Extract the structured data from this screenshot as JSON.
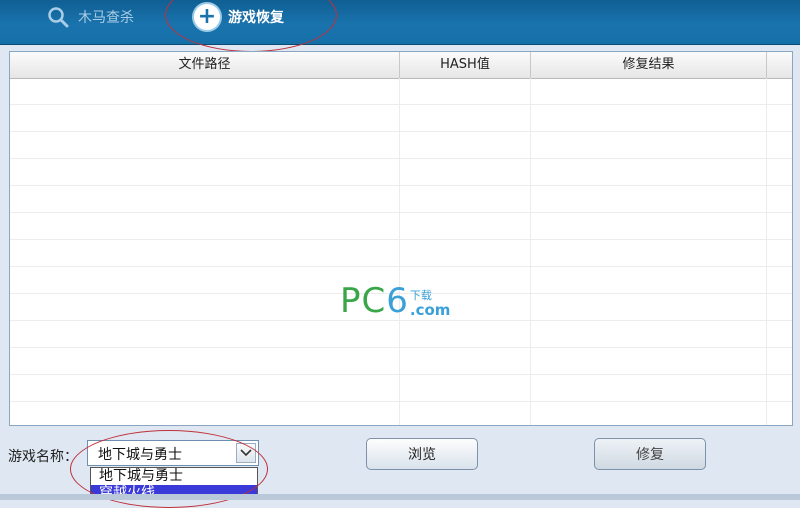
{
  "toolbar": {
    "scan_label": "木马查杀",
    "repair_label": "游戏恢复"
  },
  "table": {
    "headers": [
      "文件路径",
      "HASH值",
      "修复结果"
    ],
    "rows": []
  },
  "watermark": {
    "brand": "PC",
    "digit": "6",
    "cn": "下载",
    "com": ".com"
  },
  "controls": {
    "game_name_label": "游戏名称：",
    "game_selected": "地下城与勇士",
    "game_options": [
      "地下城与勇士",
      "穿越火线"
    ],
    "browse_label": "浏览",
    "repair_label": "修复"
  },
  "colors": {
    "toolbar_bg": "#1a73ad",
    "watermark_green": "#3aa64a",
    "watermark_blue": "#3aa0d8",
    "selected_option_bg": "#3a3ad8",
    "highlight_circle": "#c0303a"
  },
  "icons": {
    "scan": "magnifier-icon",
    "repair": "plus-circle-icon",
    "dropdown": "chevron-down-icon"
  }
}
